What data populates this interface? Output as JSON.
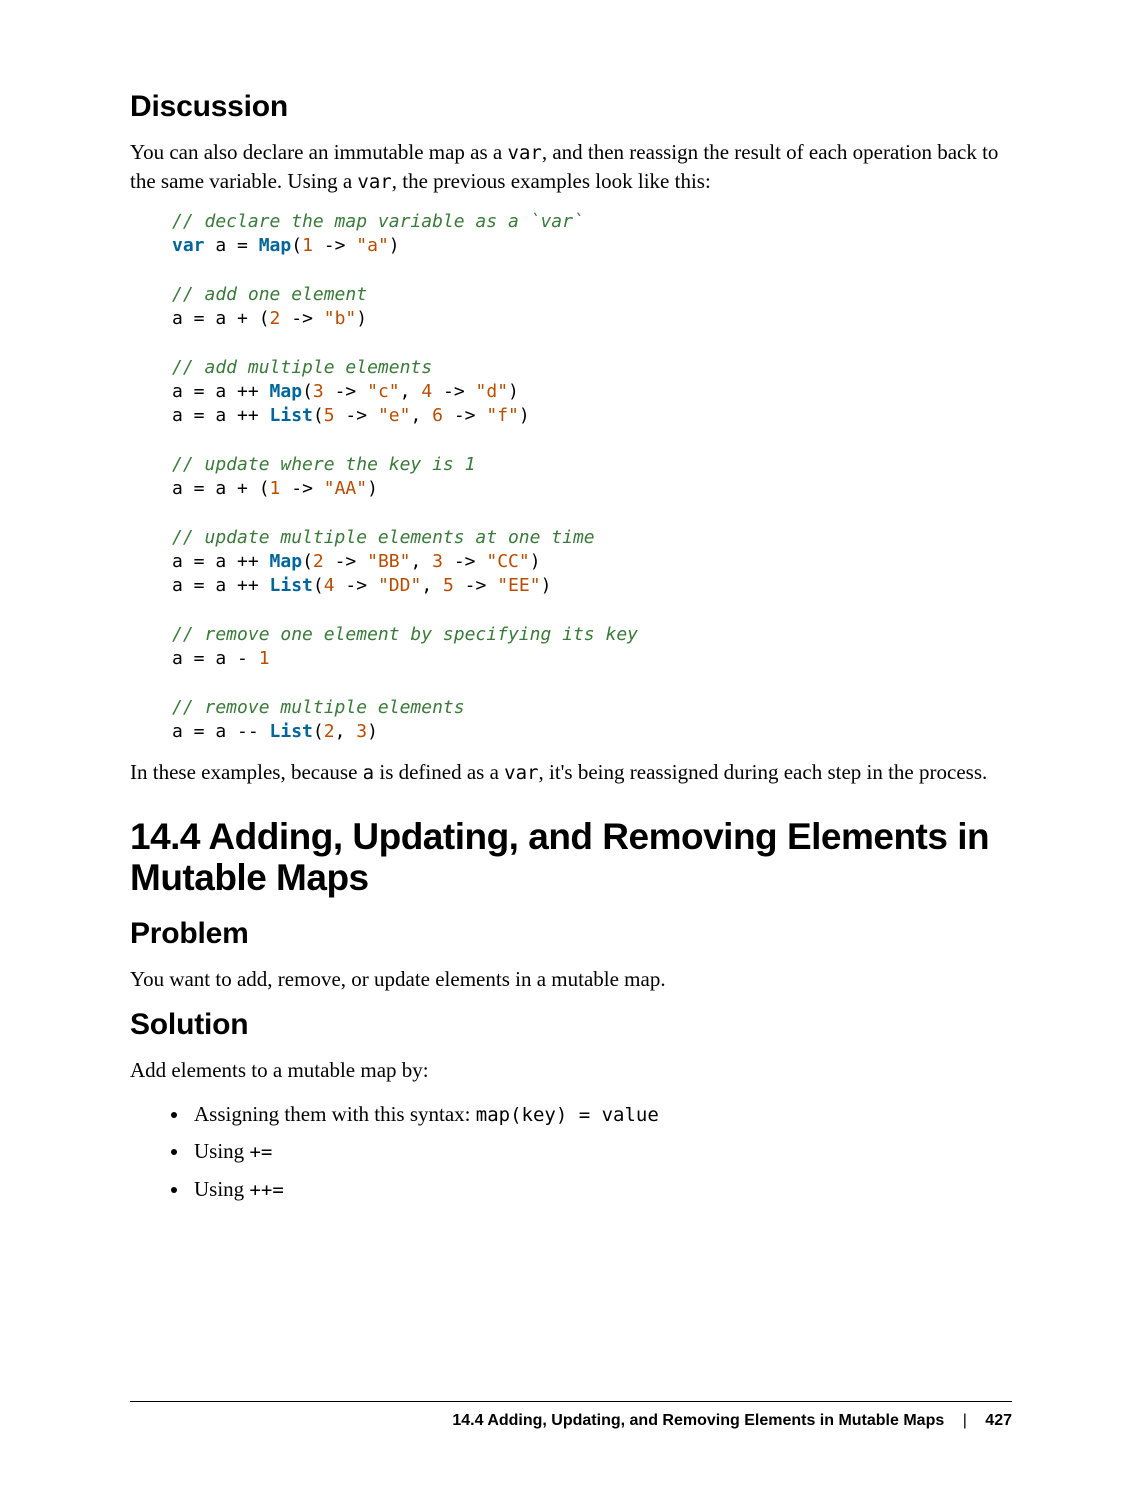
{
  "discussion": {
    "heading": "Discussion",
    "para1_a": "You can also declare an immutable map as a ",
    "para1_code1": "var",
    "para1_b": ", and then reassign the result of each operation back to the same variable. Using a ",
    "para1_code2": "var",
    "para1_c": ", the previous examples look like this:",
    "para2_a": "In these examples, because ",
    "para2_code1": "a",
    "para2_b": " is defined as a ",
    "para2_code2": "var",
    "para2_c": ", it's being reassigned during each step in the process."
  },
  "code": {
    "c1": "// declare the map variable as a `var`",
    "l1_kw": "var",
    "l1_a": " a = ",
    "l1_type": "Map",
    "l1_b": "(",
    "l1_n1": "1",
    "l1_c": " -> ",
    "l1_s1": "\"a\"",
    "l1_d": ")",
    "c2": "// add one element",
    "l2_a": "a = a + (",
    "l2_n1": "2",
    "l2_b": " -> ",
    "l2_s1": "\"b\"",
    "l2_c": ")",
    "c3": "// add multiple elements",
    "l3_a": "a = a ++ ",
    "l3_type": "Map",
    "l3_b": "(",
    "l3_n1": "3",
    "l3_c": " -> ",
    "l3_s1": "\"c\"",
    "l3_d": ", ",
    "l3_n2": "4",
    "l3_e": " -> ",
    "l3_s2": "\"d\"",
    "l3_f": ")",
    "l4_a": "a = a ++ ",
    "l4_type": "List",
    "l4_b": "(",
    "l4_n1": "5",
    "l4_c": " -> ",
    "l4_s1": "\"e\"",
    "l4_d": ", ",
    "l4_n2": "6",
    "l4_e": " -> ",
    "l4_s2": "\"f\"",
    "l4_f": ")",
    "c4": "// update where the key is 1",
    "l5_a": "a = a + (",
    "l5_n1": "1",
    "l5_b": " -> ",
    "l5_s1": "\"AA\"",
    "l5_c": ")",
    "c5": "// update multiple elements at one time",
    "l6_a": "a = a ++ ",
    "l6_type": "Map",
    "l6_b": "(",
    "l6_n1": "2",
    "l6_c": " -> ",
    "l6_s1": "\"BB\"",
    "l6_d": ", ",
    "l6_n2": "3",
    "l6_e": " -> ",
    "l6_s2": "\"CC\"",
    "l6_f": ")",
    "l7_a": "a = a ++ ",
    "l7_type": "List",
    "l7_b": "(",
    "l7_n1": "4",
    "l7_c": " -> ",
    "l7_s1": "\"DD\"",
    "l7_d": ", ",
    "l7_n2": "5",
    "l7_e": " -> ",
    "l7_s2": "\"EE\"",
    "l7_f": ")",
    "c6": "// remove one element by specifying its key",
    "l8_a": "a = a - ",
    "l8_n1": "1",
    "c7": "// remove multiple elements",
    "l9_a": "a = a -- ",
    "l9_type": "List",
    "l9_b": "(",
    "l9_n1": "2",
    "l9_c": ", ",
    "l9_n2": "3",
    "l9_d": ")"
  },
  "recipe": {
    "heading": "14.4 Adding, Updating, and Removing Elements in Mutable Maps",
    "problem_heading": "Problem",
    "problem_text": "You want to add, remove, or update elements in a mutable map.",
    "solution_heading": "Solution",
    "solution_intro": "Add elements to a mutable map by:",
    "bullet1_a": "Assigning them with this syntax: ",
    "bullet1_code": "map(key) = value",
    "bullet2_a": "Using ",
    "bullet2_code": "+=",
    "bullet3_a": "Using ",
    "bullet3_code": "++="
  },
  "footer": {
    "title": "14.4 Adding, Updating, and Removing Elements in Mutable Maps",
    "sep": "|",
    "page": "427"
  }
}
